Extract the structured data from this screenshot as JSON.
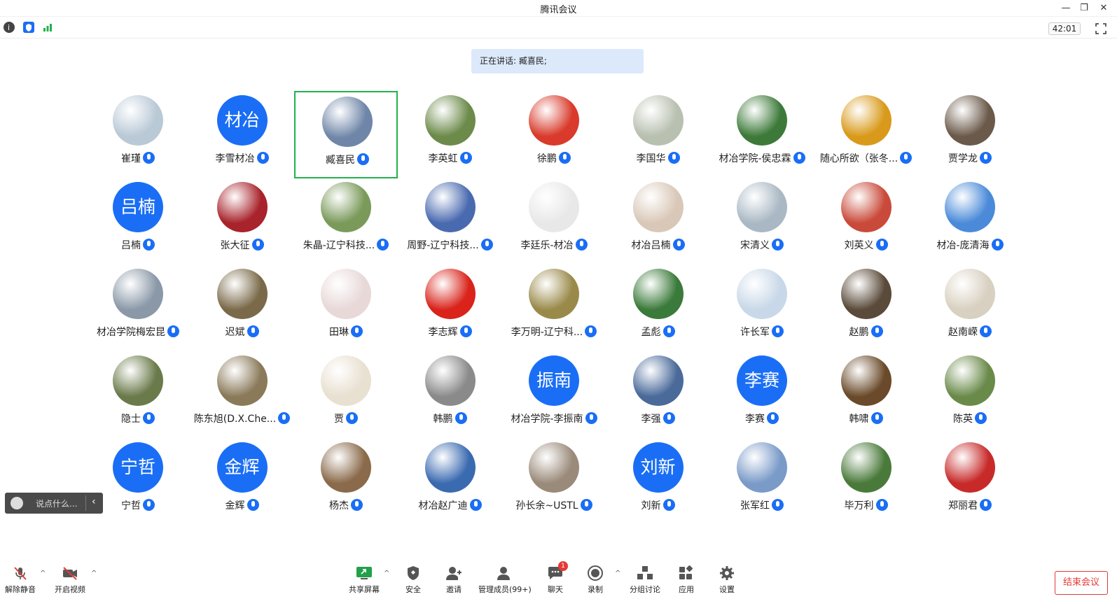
{
  "window": {
    "title": "腾讯会议"
  },
  "topbar": {
    "timer": "42:01"
  },
  "speaking": "正在讲话: 臧喜民;",
  "participants": [
    {
      "name": "崔瑾",
      "avatar": "bear-photo",
      "color": "#b9c9d6"
    },
    {
      "name": "李雪材冶",
      "avatar_text": "材冶"
    },
    {
      "name": "臧喜民",
      "avatar": "landscape-photo",
      "color": "#6f86a8",
      "active": true
    },
    {
      "name": "李英虹",
      "avatar": "forest-photo",
      "color": "#6c8a4a"
    },
    {
      "name": "徐鹏",
      "avatar": "tiger-drawing",
      "color": "#d93a2b"
    },
    {
      "name": "李国华",
      "avatar": "birds-photo",
      "color": "#b8c0b0"
    },
    {
      "name": "材冶学院-侯忠霖",
      "avatar": "lake-photo",
      "color": "#3d7a3a"
    },
    {
      "name": "随心所欲（张冬...",
      "avatar": "flowers-photo",
      "color": "#d99a1b"
    },
    {
      "name": "贾学龙",
      "avatar": "person-photo",
      "color": "#6b5a4a"
    },
    {
      "name": "吕楠",
      "avatar_text": "吕楠"
    },
    {
      "name": "张大征",
      "avatar": "red-badge",
      "color": "#a8232b"
    },
    {
      "name": "朱晶-辽宁科技...",
      "avatar": "clover-photo",
      "color": "#7a9a5a"
    },
    {
      "name": "周野-辽宁科技...",
      "avatar": "stitch-cartoon",
      "color": "#4a6ab0"
    },
    {
      "name": "李廷乐-材冶",
      "avatar": "portrait-photo",
      "color": "#e8e8e8"
    },
    {
      "name": "材冶吕楠",
      "avatar": "dog-photo",
      "color": "#d9c8b8"
    },
    {
      "name": "宋清义",
      "avatar": "sea-photo",
      "color": "#a9b8c4"
    },
    {
      "name": "刘英义",
      "avatar": "tree-photo",
      "color": "#c94a3a"
    },
    {
      "name": "材冶-庞清海",
      "avatar": "cartoon-boy",
      "color": "#4a8ad9"
    },
    {
      "name": "材冶学院梅宏昆",
      "avatar": "sky-photo",
      "color": "#8a98a8"
    },
    {
      "name": "迟斌",
      "avatar": "hiker-photo",
      "color": "#7a6a4a"
    },
    {
      "name": "田琳",
      "avatar": "anime-drawing",
      "color": "#e8d8d8"
    },
    {
      "name": "李志辉",
      "avatar": "red-emblem",
      "color": "#d9231b"
    },
    {
      "name": "李万明-辽宁科...",
      "avatar": "autumn-photo",
      "color": "#9a8a4a"
    },
    {
      "name": "孟彪",
      "avatar": "field-photo",
      "color": "#3a7a3a"
    },
    {
      "name": "许长军",
      "avatar": "runner-photo",
      "color": "#c8d8e8"
    },
    {
      "name": "赵鹏",
      "avatar": "man-photo",
      "color": "#5a4a3a"
    },
    {
      "name": "赵南嵘",
      "avatar": "woman-photo",
      "color": "#d8d0c0"
    },
    {
      "name": "隐士",
      "avatar": "rock-photo",
      "color": "#6a7a4a"
    },
    {
      "name": "陈东旭(D.X.Che...",
      "avatar": "climber-photo",
      "color": "#8a7a5a"
    },
    {
      "name": "贾",
      "avatar": "neu-logo",
      "color": "#e8e0d0"
    },
    {
      "name": "韩鹏",
      "avatar": "office-photo",
      "color": "#8a8a8a"
    },
    {
      "name": "材冶学院-李振南",
      "avatar_text": "振南"
    },
    {
      "name": "李强",
      "avatar": "mountain-photo",
      "color": "#4a6a9a"
    },
    {
      "name": "李赛",
      "avatar_text": "李赛"
    },
    {
      "name": "韩啸",
      "avatar": "man2-photo",
      "color": "#6a4a2a"
    },
    {
      "name": "陈英",
      "avatar": "hills-photo",
      "color": "#6a8a4a"
    },
    {
      "name": "宁哲",
      "avatar_text": "宁哲"
    },
    {
      "name": "金辉",
      "avatar_text": "金辉"
    },
    {
      "name": "杨杰",
      "avatar": "sunset-photo",
      "color": "#8a6a4a"
    },
    {
      "name": "材冶赵广迪",
      "avatar": "sun-photo",
      "color": "#3a6ab0"
    },
    {
      "name": "孙长余~USTL",
      "avatar": "kid-photo",
      "color": "#9a8a7a"
    },
    {
      "name": "刘新",
      "avatar_text": "刘新"
    },
    {
      "name": "张军红",
      "avatar": "winter-photo",
      "color": "#7a9ac8"
    },
    {
      "name": "毕万利",
      "avatar": "child-photo",
      "color": "#4a7a3a"
    },
    {
      "name": "郑丽君",
      "avatar": "tiger-2022",
      "color": "#c82a2a"
    }
  ],
  "chat": {
    "placeholder": "说点什么..."
  },
  "bottom": {
    "unmute": "解除静音",
    "video": "开启视频",
    "share": "共享屏幕",
    "security": "安全",
    "invite": "邀请",
    "members": "管理成员(99+)",
    "chat": "聊天",
    "chat_badge": "1",
    "record": "录制",
    "breakout": "分组讨论",
    "apps": "应用",
    "settings": "设置",
    "end": "结束会议"
  },
  "colors": {
    "accent": "#1a6ef5",
    "active_border": "#22b14c",
    "end": "#e53935"
  }
}
